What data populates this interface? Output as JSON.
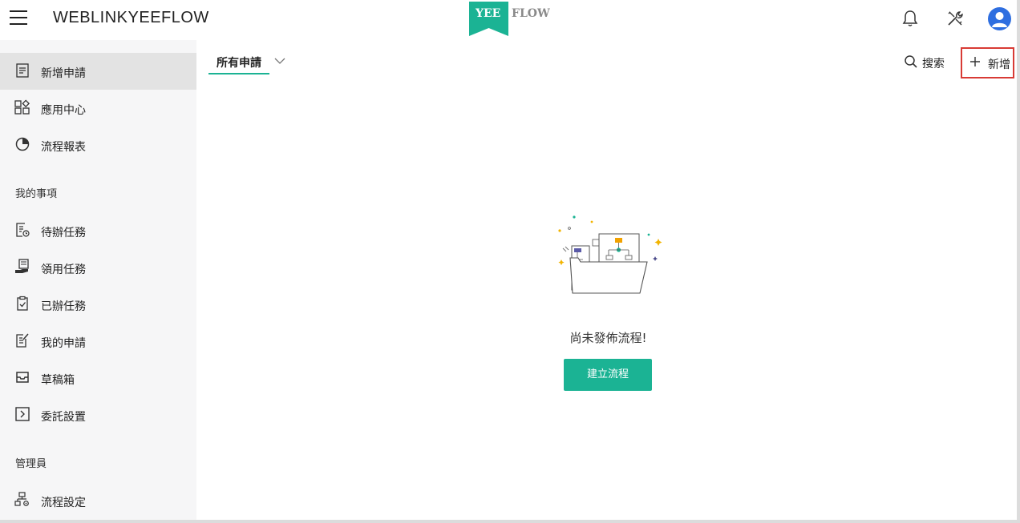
{
  "topbar": {
    "app_title": "WEBLINKYEEFLOW",
    "logo": {
      "left_text": "YEE",
      "right_text": "FLOW",
      "flag_color": "#1bb394"
    },
    "icons": [
      "bell-icon",
      "tools-icon",
      "user-avatar-icon"
    ]
  },
  "sidebar": {
    "items": [
      {
        "label": "新增申請",
        "icon": "form-icon",
        "active": true
      },
      {
        "label": "應用中心",
        "icon": "apps-icon"
      },
      {
        "label": "流程報表",
        "icon": "pie-chart-icon"
      }
    ],
    "section_my": "我的事項",
    "my_items": [
      {
        "label": "待辦任務",
        "icon": "todo-icon"
      },
      {
        "label": "領用任務",
        "icon": "claim-icon"
      },
      {
        "label": "已辦任務",
        "icon": "done-icon"
      },
      {
        "label": "我的申請",
        "icon": "my-request-icon"
      },
      {
        "label": "草稿箱",
        "icon": "inbox-icon"
      },
      {
        "label": "委託設置",
        "icon": "delegate-icon"
      }
    ],
    "section_admin": "管理員",
    "admin_items": [
      {
        "label": "流程設定",
        "icon": "flow-settings-icon"
      }
    ]
  },
  "main": {
    "tab_label": "所有申請",
    "search_label": "搜索",
    "add_label": "新增",
    "empty_text": "尚未發佈流程!",
    "create_button": "建立流程"
  },
  "colors": {
    "accent": "#1bb394",
    "highlight_box": "#d83b35",
    "avatar": "#2e6ee0"
  }
}
